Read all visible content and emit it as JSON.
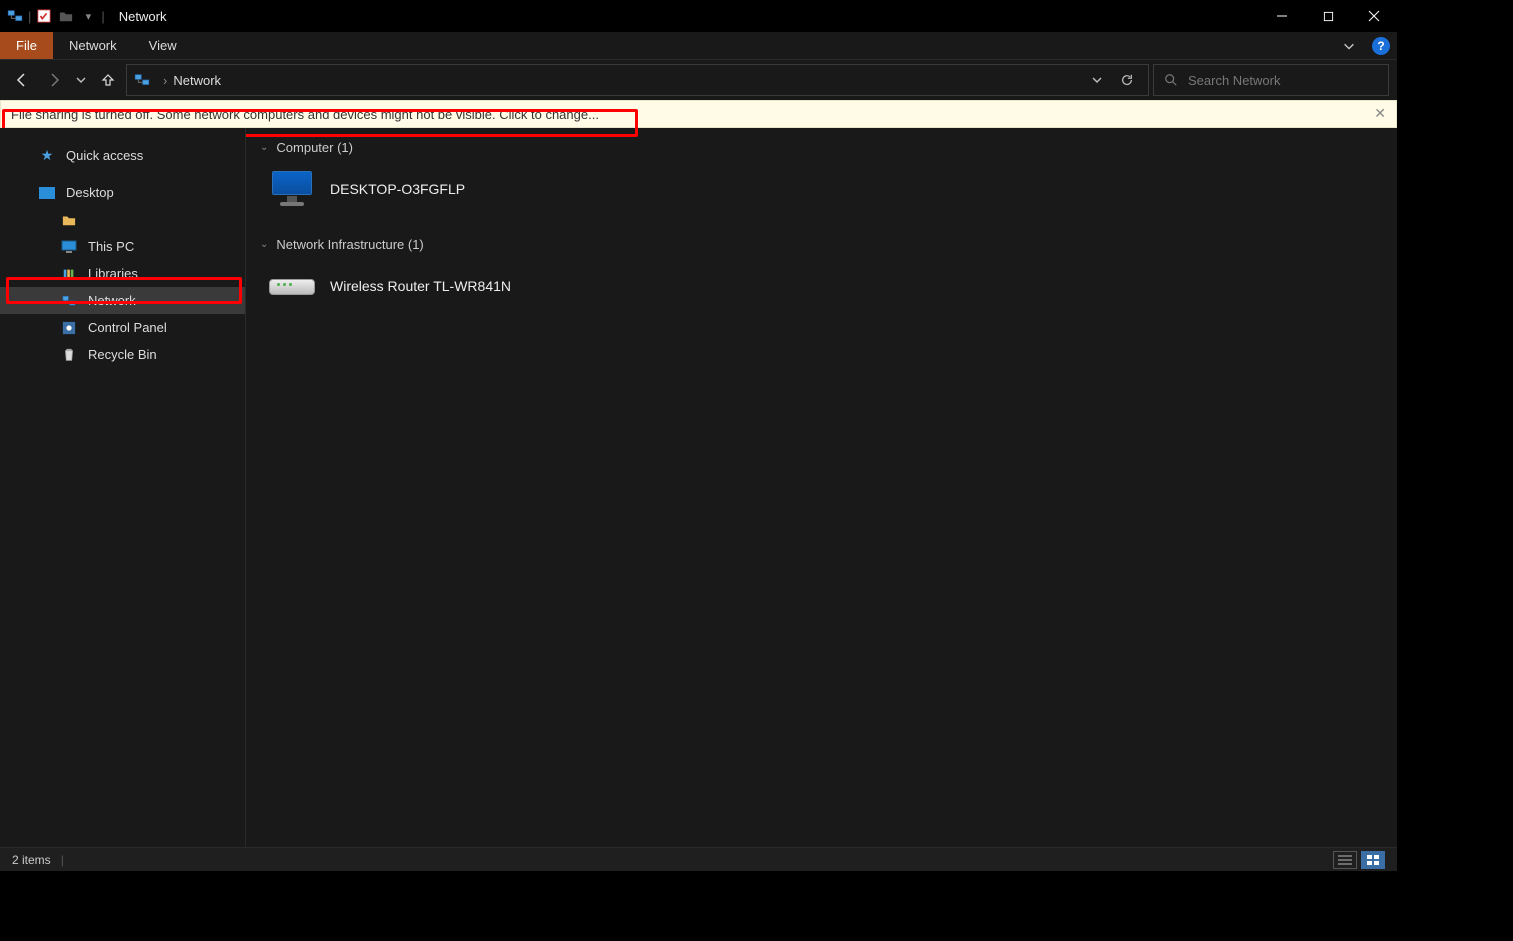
{
  "window": {
    "title": "Network"
  },
  "ribbon": {
    "file": "File",
    "tabs": [
      "Network",
      "View"
    ]
  },
  "nav": {
    "breadcrumb": "Network",
    "search_placeholder": "Search Network"
  },
  "infobar": {
    "text": "File sharing is turned off. Some network computers and devices might not be visible. Click to change..."
  },
  "sidebar": {
    "quick_access": "Quick access",
    "desktop": "Desktop",
    "this_pc": "This PC",
    "libraries": "Libraries",
    "network": "Network",
    "control_panel": "Control Panel",
    "recycle_bin": "Recycle Bin"
  },
  "content": {
    "groups": [
      {
        "header": "Computer (1)",
        "items": [
          {
            "label": "DESKTOP-O3FGFLP",
            "icon": "monitor"
          }
        ]
      },
      {
        "header": "Network Infrastructure (1)",
        "items": [
          {
            "label": "Wireless Router TL-WR841N",
            "icon": "router"
          }
        ]
      }
    ]
  },
  "statusbar": {
    "count": "2 items"
  }
}
